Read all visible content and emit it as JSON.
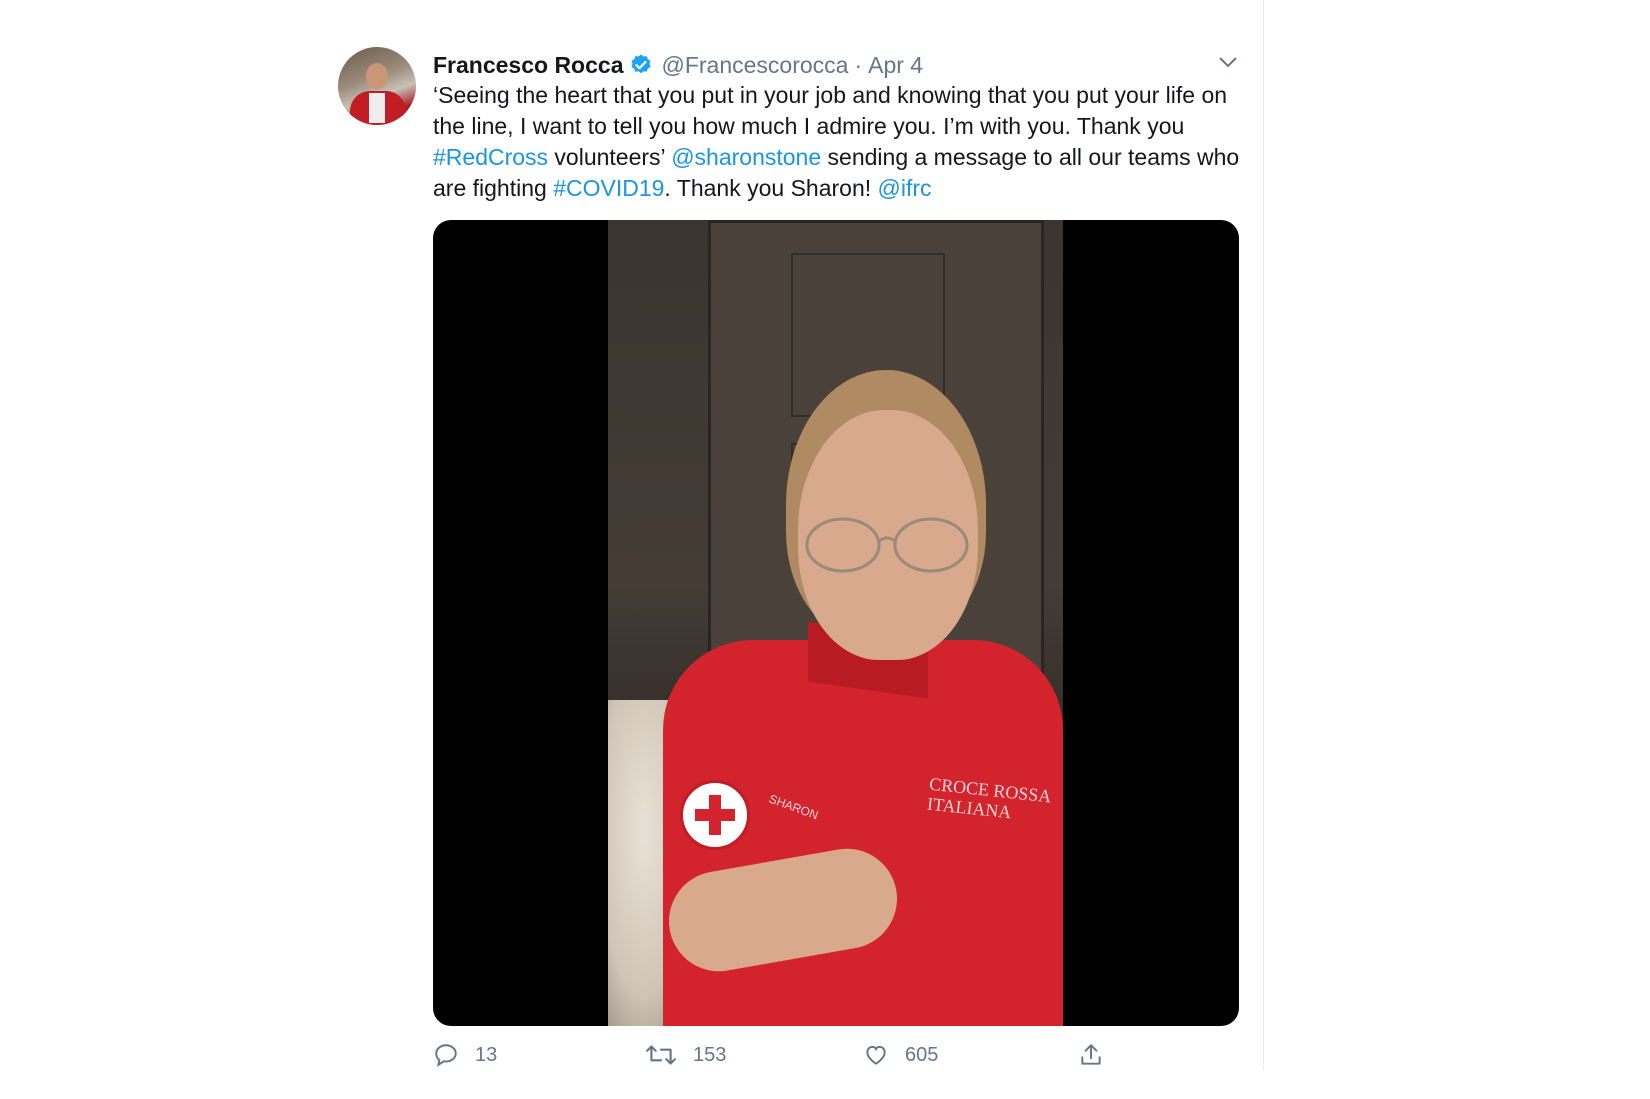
{
  "tweet": {
    "author_name": "Francesco Rocca",
    "handle": "@Francescorocca",
    "separator": "·",
    "date": "Apr 4",
    "text_parts": {
      "p1": "‘Seeing the heart that you put in your job and knowing that you put your life on the line, I want to tell you how much I admire you. I’m with you. Thank you ",
      "l1": "#RedCross",
      "p2": " volunteers’ ",
      "l2": "@sharonstone",
      "p3": " sending a message to all our teams who are fighting ",
      "l3": "#COVID19",
      "p4": ". Thank you Sharon! ",
      "l4": "@ifrc"
    },
    "media": {
      "shirt_text_1": "CROCE ROSSA",
      "shirt_text_2": "ITALIANA",
      "name_tag": "SHARON"
    },
    "actions": {
      "replies": "13",
      "retweets": "153",
      "likes": "605"
    }
  },
  "colors": {
    "link": "#1b95e0",
    "text": "#14171a",
    "muted": "#657786",
    "verified": "#1da1f2"
  },
  "icons": [
    "verified-badge-icon",
    "chevron-down-icon",
    "reply-icon",
    "retweet-icon",
    "like-icon",
    "share-icon"
  ]
}
